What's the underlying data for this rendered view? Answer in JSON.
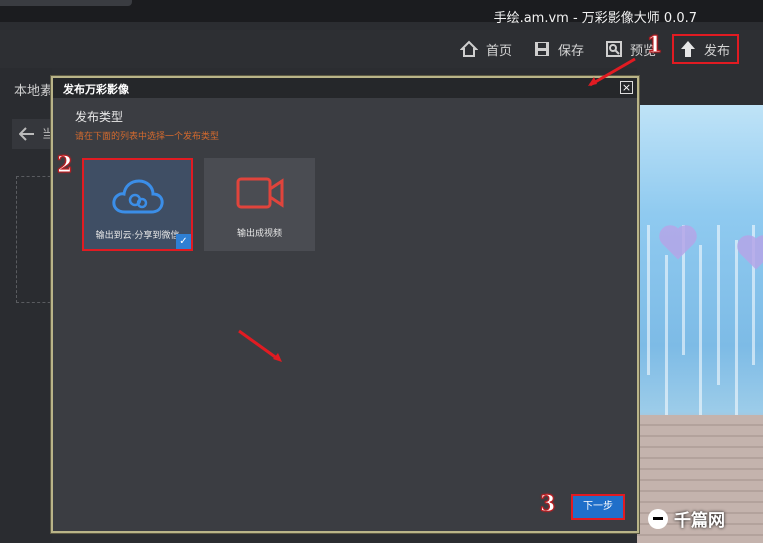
{
  "window": {
    "title": "手绘.am.vm - 万彩影像大师 0.0.7"
  },
  "toolbar": {
    "home_label": "首页",
    "save_label": "保存",
    "preview_label": "预览",
    "publish_label": "发布"
  },
  "left_panel": {
    "title": "本地素材",
    "back_label": "当"
  },
  "dialog": {
    "title": "发布万彩影像",
    "close_glyph": "×",
    "section_title": "发布类型",
    "hint": "请在下面的列表中选择一个发布类型",
    "options": [
      {
        "label": "输出到云·分享到微信",
        "icon": "cloud-icon",
        "selected": true,
        "color": "#3b8ee8"
      },
      {
        "label": "输出成视频",
        "icon": "video-camera-icon",
        "selected": false,
        "color": "#e0443c"
      }
    ],
    "check_glyph": "✓",
    "next_label": "下一步"
  },
  "annotations": {
    "step1": "1",
    "step2": "2",
    "step3": "3"
  },
  "watermark": {
    "text": "千篇网"
  },
  "colors": {
    "highlight": "#e11b22",
    "primary": "#1f6fc9",
    "hint": "#d46a2e"
  }
}
